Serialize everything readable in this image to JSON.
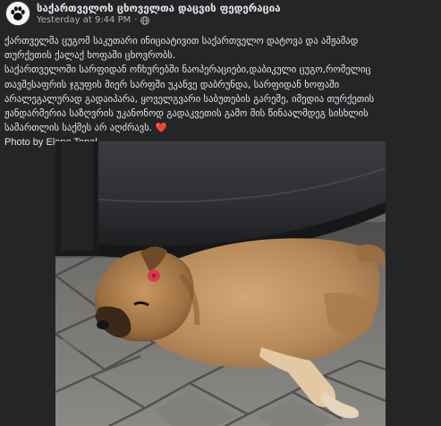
{
  "post": {
    "page_name": "საქართველოს ცხოველთა დაცვის ფედერაცია",
    "timestamp": "Yesterday at 9:44 PM",
    "separator": "·",
    "privacy_icon": "globe-icon",
    "avatar_icon": "paw-icon",
    "text_lines": [
      "ქართველმა ცუგომ საკუთარი ინიციატივით საქართველო დატოვა და ამჟამად",
      "თურქეთის ქალაქ ხოფაში ცხოვრობს.",
      "საქართველოში სარფიდან ოჩხურებში ნაოპერაციები,დაბიკული ცუგო,რომელიც",
      "თავშესაფრის ჯგუფის მიერ სარფში უკანვე დაბრუნდა, სარფიდან ხოფაში",
      "არალეგალურად გადაიპარა, ყოველგვარი საბუთების გარეშე, იმედია თურქეთის",
      "ჟანდარმერია საზღვრის უკანონოდ გადაკვეთის გამო მის წინაალმდეგ სისხლის",
      "სამართლის საქმეს არ აღძრავს."
    ],
    "heart_emoji": "❤️",
    "photo_credit": "Photo by Elene Topal"
  },
  "colors": {
    "background": "#242526",
    "primary_text": "#e4e6eb",
    "secondary_text": "#b0b3b8",
    "heart": "#e0245e"
  }
}
